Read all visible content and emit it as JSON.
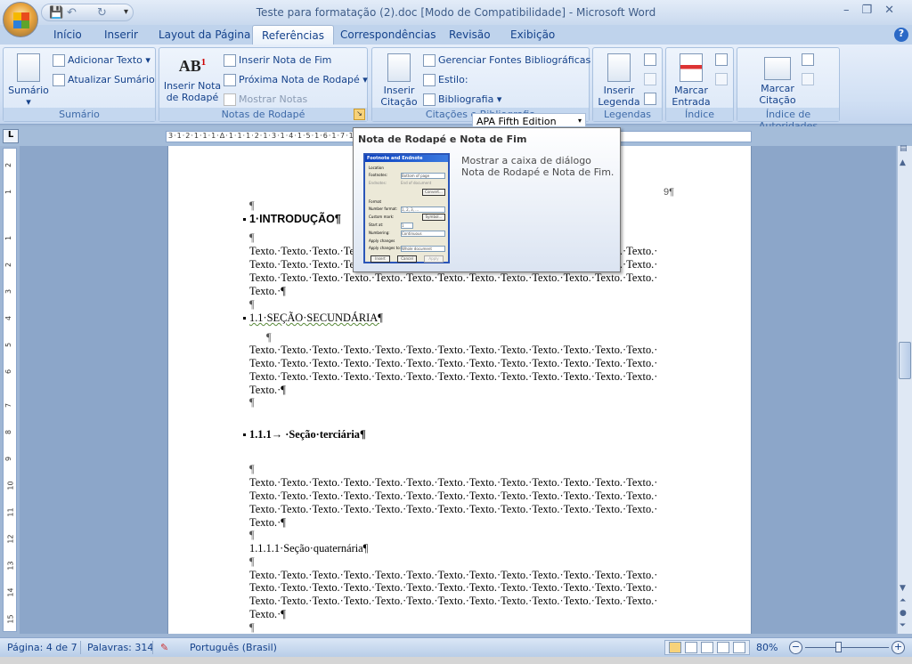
{
  "window": {
    "title": "Teste para formatação (2).doc [Modo de Compatibilidade] - Microsoft Word",
    "controls": [
      "–",
      "❐",
      "✕"
    ]
  },
  "qat": {
    "save": "💾",
    "undo": "↶",
    "redo": "↻",
    "customize": "▾"
  },
  "tabs": [
    {
      "label": "Início"
    },
    {
      "label": "Inserir"
    },
    {
      "label": "Layout da Página"
    },
    {
      "label": "Referências",
      "active": true
    },
    {
      "label": "Correspondências"
    },
    {
      "label": "Revisão"
    },
    {
      "label": "Exibição"
    }
  ],
  "help": "?",
  "ribbon": {
    "sumario": {
      "label": "Sumário",
      "button": "Sumário",
      "add_text": "Adicionar Texto ▾",
      "update": "Atualizar Sumário"
    },
    "notas": {
      "label": "Notas de Rodapé",
      "insert_footnote": "Inserir Nota de Rodapé",
      "insert_endnote": "Inserir Nota de Fim",
      "next_footnote": "Próxima Nota de Rodapé ▾",
      "show_notes": "Mostrar Notas",
      "launcher": "↘"
    },
    "citacoes": {
      "label": "Citações e Bibliografia",
      "insert_citation": "Inserir Citação ▾",
      "manage_sources": "Gerenciar Fontes Bibliográficas",
      "style_label": "Estilo:",
      "style_value": "APA Fifth Edition",
      "bibliography": "Bibliografia ▾"
    },
    "legendas": {
      "label": "Legendas",
      "insert_caption": "Inserir Legenda"
    },
    "indice": {
      "label": "Índice",
      "mark_entry": "Marcar Entrada"
    },
    "autoridades": {
      "label": "Índice de Autoridades",
      "mark_citation": "Marcar Citação"
    }
  },
  "ruler": {
    "horizontal": "3·1·2·1·1·1·Δ·1·1·1·2·1·3·1·4·1·5·1·6·1·7·1·8·1·9·1·10·1·11·1·12·1·13·1·14·1·15·∆16·1·17·1·18·1·",
    "vertical": [
      "2",
      "1",
      "1",
      "2",
      "3",
      "4",
      "5",
      "6",
      "7",
      "8",
      "9",
      "10",
      "11",
      "12",
      "13",
      "14",
      "15"
    ],
    "tab_selector": "L"
  },
  "tooltip": {
    "title": "Nota de Rodapé e Nota de Fim",
    "description": "Mostrar a caixa de diálogo Nota de Rodapé e Nota de Fim.",
    "preview": {
      "title": "Footnote and Endnote",
      "location": "Location",
      "footnotes": "Footnotes:",
      "footnotes_value": "Bottom of page",
      "endnotes": "Endnotes:",
      "endnotes_value": "End of document",
      "convert": "Convert...",
      "format": "Format",
      "number_format": "Number format:",
      "number_format_value": "1, 2, 3, ...",
      "custom_mark": "Custom mark:",
      "symbol": "Symbol...",
      "start_at": "Start at:",
      "start_at_value": "1",
      "numbering": "Numbering:",
      "numbering_value": "Continuous",
      "apply_changes": "Apply changes",
      "apply_to": "Apply changes to:",
      "apply_to_value": "Whole document",
      "insert": "Insert",
      "cancel": "Cancel",
      "apply": "Apply"
    }
  },
  "document": {
    "page_number": "9¶",
    "pilcrow": "¶",
    "h1": "1·INTRODUÇÃO¶",
    "h2": "1.1·SEÇÃO·SECUNDÁRIA¶",
    "h3": "1.1.1→ ·Seção·terciária¶",
    "h4": "1.1.1.1·Seção·quaternária¶",
    "text_line": "Texto.·Texto.·Texto.·Texto.·Texto.·Texto.·Texto.·Texto.·Texto.·Texto.·Texto.·Texto.·Texto.·",
    "text_last": "Texto.·¶"
  },
  "status": {
    "page": "Página: 4 de 7",
    "words": "Palavras: 314",
    "language": "Português (Brasil)",
    "zoom": "80%",
    "zoom_level_percent": 80,
    "zoom_out": "−",
    "zoom_in": "+"
  },
  "colors": {
    "ribbon": "#dbe7f7",
    "accent": "#15428b",
    "doc_background": "#8ca6c9"
  }
}
